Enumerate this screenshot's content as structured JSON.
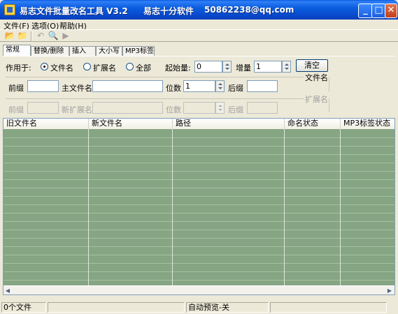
{
  "window": {
    "title": "易志文件批量改名工具 V3.2",
    "company": "易志十分软件",
    "contact": "50862238@qq.com",
    "minimize_label": "_",
    "maximize_label": "□",
    "close_label": "✕"
  },
  "menu": {
    "items": [
      {
        "label": "文件(F)"
      },
      {
        "label": "选项(O)"
      },
      {
        "label": "帮助(H)"
      }
    ]
  },
  "toolbar": {
    "buttons": [
      {
        "icon": "open-folder-icon",
        "glyph": "📂"
      },
      {
        "icon": "open-files-icon",
        "glyph": "📁"
      },
      {
        "icon": "undo-icon",
        "glyph": "↶"
      },
      {
        "icon": "search-icon",
        "glyph": "🔍"
      },
      {
        "icon": "run-icon",
        "glyph": "▶"
      }
    ]
  },
  "tabs": [
    {
      "label": "常规",
      "active": true
    },
    {
      "label": "替换/删除"
    },
    {
      "label": "插入"
    },
    {
      "label": "大小写"
    },
    {
      "label": "MP3标签"
    }
  ],
  "general": {
    "apply_to_label": "作用于:",
    "apply_options": [
      {
        "label": "文件名",
        "checked": true
      },
      {
        "label": "扩展名",
        "checked": false
      },
      {
        "label": "全部",
        "checked": false
      }
    ],
    "start_label": "起始量:",
    "start_value": "0",
    "increment_label": "增量",
    "increment_value": "1",
    "clear_label": "清空",
    "filename_group_title": "文件名",
    "prefix_label": "前缀",
    "prefix_value": "",
    "main_name_label": "主文件名",
    "main_name_value": "",
    "digits_label": "位数",
    "digits_value": "1",
    "suffix_label": "后缀",
    "suffix_value": "",
    "ext_group_title": "扩展名",
    "ext_prefix_label": "前缀",
    "new_ext_label": "新扩展名",
    "ext_digits_label": "位数",
    "ext_suffix_label": "后缀"
  },
  "table": {
    "columns": [
      "旧文件名",
      "新文件名",
      "路径",
      "命名状态",
      "MP3标签状态"
    ],
    "rows": []
  },
  "statusbar": {
    "file_count": "0个文件",
    "middle": "",
    "auto_preview": "自动预览-关"
  },
  "colors": {
    "title_bar": "#0b5ddf",
    "grid_background": "#86a583",
    "face": "#ece9d8"
  }
}
